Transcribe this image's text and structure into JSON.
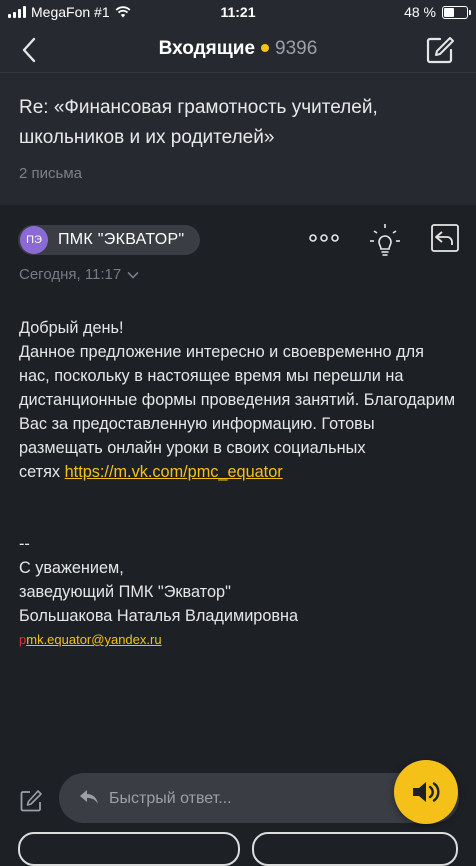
{
  "status_bar": {
    "carrier": "MegaFon #1",
    "time": "11:21",
    "battery_text": "48 %",
    "battery_level": 0.48
  },
  "nav": {
    "folder": "Входящие",
    "unread_count": "9396"
  },
  "thread": {
    "subject": "Re: «Финансовая грамотность учителей, школьников и их родителей»",
    "message_count": "2 письма"
  },
  "message": {
    "avatar_initials": "ПЭ",
    "sender": "ПМК \"ЭКВАТОР\"",
    "date": "Сегодня, 11:17",
    "greeting": "Добрый день!",
    "body": "Данное предложение интересно и своевременно для нас, поскольку в настоящее время мы перешли на дистанционные формы проведения занятий. Благодарим Вас за предоставленную информацию. Готовы размещать онлайн уроки в своих социальных",
    "body_end": "сетях",
    "link": "https://m.vk.com/pmc_equator",
    "sig_dash": "--",
    "sig_line1": "С уважением,",
    "sig_line2": "заведующий ПМК \"Экватор\"",
    "sig_line3": "Большакова Наталья Владимировна",
    "email_first": "p",
    "email_rest": "mk.equator@yandex.ru"
  },
  "quick_reply": {
    "placeholder": "Быстрый ответ..."
  },
  "colors": {
    "accent": "#f5c118",
    "background": "#1d2126",
    "header": "#262a30",
    "avatar": "#8b6ad6"
  },
  "icons": [
    "back-chevron-icon",
    "compose-icon",
    "more-dots-icon",
    "lightbulb-icon",
    "reply-icon",
    "edit-icon",
    "reply-arrow-icon",
    "speaker-icon"
  ]
}
